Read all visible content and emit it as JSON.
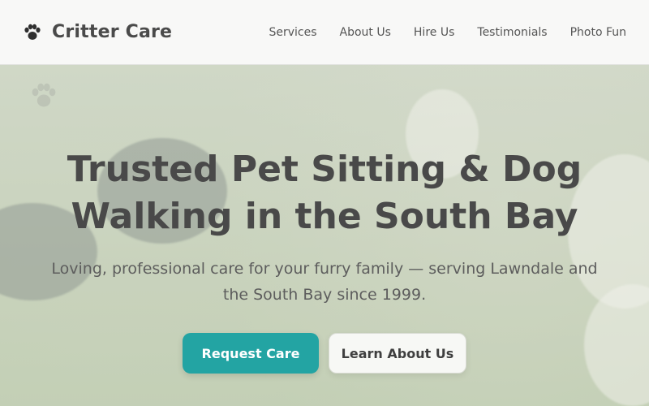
{
  "header": {
    "brand_name": "Critter Care",
    "brand_icon": "paw-icon",
    "nav": [
      "Services",
      "About Us",
      "Hire Us",
      "Testimonials",
      "Photo Fun"
    ]
  },
  "hero": {
    "title_line1": "Trusted Pet Sitting & Dog",
    "title_line2": "Walking in the South Bay",
    "subtitle_line1": "Loving, professional care for your furry family — serving Lawndale and",
    "subtitle_line2": "the South Bay since 1999.",
    "primary_button": "Request Care",
    "secondary_button": "Learn About Us"
  },
  "colors": {
    "primary": "#23a4a3",
    "text": "#494949",
    "header_bg": "#f8f8f7"
  }
}
